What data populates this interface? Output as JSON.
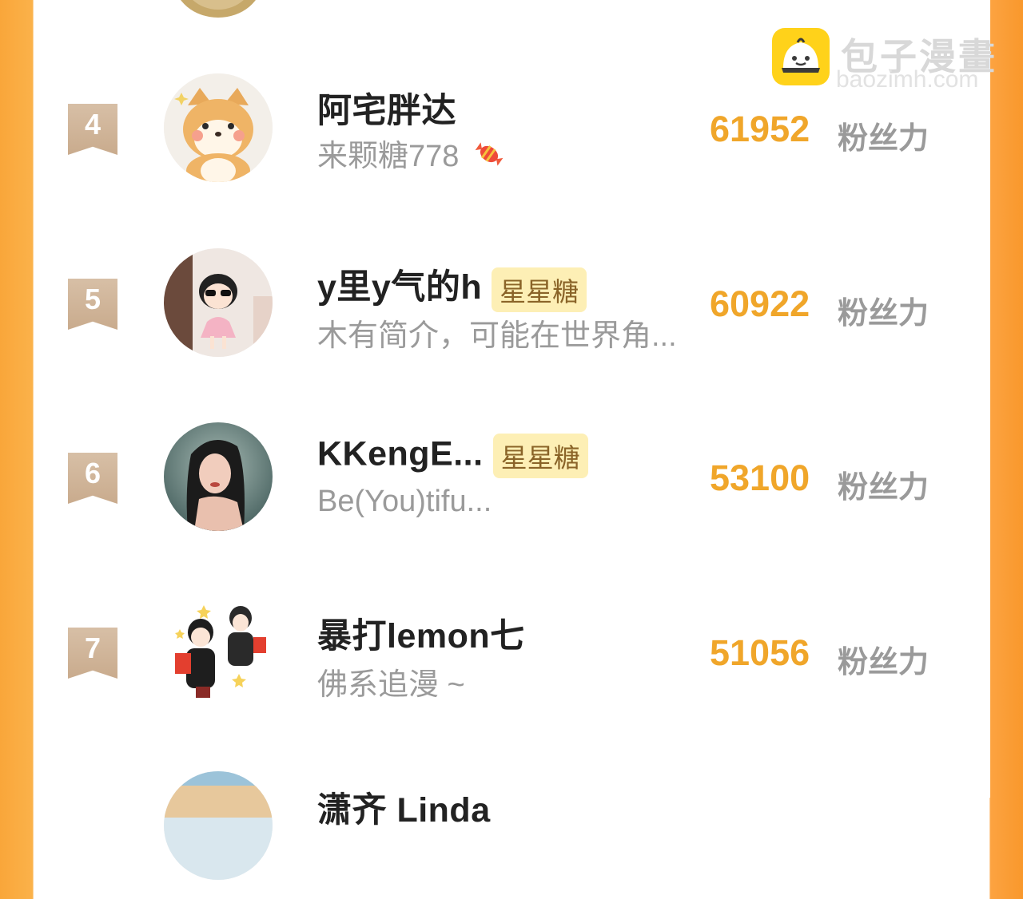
{
  "watermark": {
    "brand_cn": "包子漫畫",
    "brand_en": "baozimh.com"
  },
  "fans_unit": "粉丝力",
  "badge_label": "星星糖",
  "colors": {
    "accent_orange": "#f0a62a",
    "rank_flag": "#c9ab8d",
    "badge_bg": "#fdefb5",
    "side_border": "#f9a63a"
  },
  "entries": [
    {
      "rank": "4",
      "name": "阿宅胖达",
      "bio": "来颗糖778",
      "score": "61952",
      "has_badge": false,
      "avatar_icon": "shiba-dog-avatar",
      "bio_icon": "candy-icon"
    },
    {
      "rank": "5",
      "name": "y里y气的h",
      "bio": "木有简介，可能在世界角...",
      "score": "60922",
      "has_badge": true,
      "avatar_icon": "cartoon-girl-avatar"
    },
    {
      "rank": "6",
      "name": "KKengE...",
      "bio": "Be(You)tifu...",
      "score": "53100",
      "has_badge": true,
      "avatar_icon": "woman-portrait-avatar"
    },
    {
      "rank": "7",
      "name": "暴打lemon七",
      "bio": "佛系追漫 ~",
      "score": "51056",
      "has_badge": false,
      "avatar_icon": "couple-cartoon-avatar"
    },
    {
      "rank": "",
      "name": "潇齐 Linda",
      "bio": "",
      "score": "",
      "has_badge": false,
      "avatar_icon": "beach-avatar"
    }
  ]
}
